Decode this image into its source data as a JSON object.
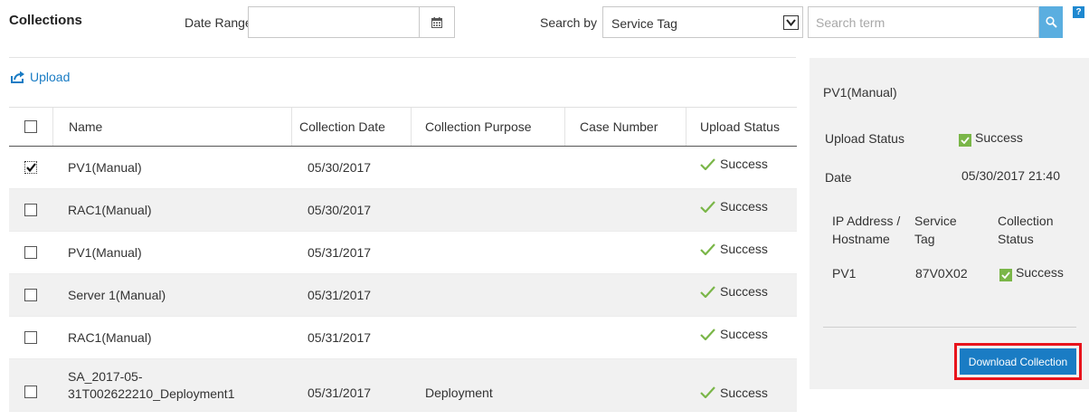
{
  "toolbar": {
    "title": "Collections",
    "date_range_label": "Date Range:",
    "date_range_value": "",
    "search_by_label": "Search by",
    "search_by_value": "Service Tag",
    "search_placeholder": "Search term",
    "help_label": "?"
  },
  "upload": {
    "label": "Upload"
  },
  "table": {
    "columns": [
      "Name",
      "Collection Date",
      "Collection Purpose",
      "Case Number",
      "Upload Status"
    ],
    "rows": [
      {
        "checked": true,
        "name": "PV1(Manual)",
        "date": "05/30/2017",
        "purpose": "",
        "case": "",
        "status": "Success"
      },
      {
        "checked": false,
        "name": "RAC1(Manual)",
        "date": "05/30/2017",
        "purpose": "",
        "case": "",
        "status": "Success"
      },
      {
        "checked": false,
        "name": "PV1(Manual)",
        "date": "05/31/2017",
        "purpose": "",
        "case": "",
        "status": "Success"
      },
      {
        "checked": false,
        "name": "Server 1(Manual)",
        "date": "05/31/2017",
        "purpose": "",
        "case": "",
        "status": "Success"
      },
      {
        "checked": false,
        "name": "RAC1(Manual)",
        "date": "05/31/2017",
        "purpose": "",
        "case": "",
        "status": "Success"
      },
      {
        "checked": false,
        "name_line1": "SA_2017-05-",
        "name_line2": "31T002622210_Deployment1",
        "date": "05/31/2017",
        "purpose": "Deployment",
        "case": "",
        "status": "Success"
      }
    ]
  },
  "details": {
    "title": "PV1(Manual)",
    "upload_status_label": "Upload Status",
    "upload_status_value": "Success",
    "date_label": "Date",
    "date_value": "05/30/2017 21:40",
    "sub_headers": {
      "ip_line1": "IP Address /",
      "ip_line2": "Hostname",
      "tag_line1": "Service",
      "tag_line2": "Tag",
      "cstatus_line1": "Collection",
      "cstatus_line2": "Status"
    },
    "entry": {
      "host": "PV1",
      "service_tag": "87V0X02",
      "status": "Success"
    },
    "download_label": "Download Collection"
  },
  "colors": {
    "accent": "#1a7cc4",
    "search_button": "#5aaee0",
    "success": "#7ab648",
    "highlight_frame": "#e8141c",
    "panel_bg": "#f1f1f1",
    "row_alt": "#f1f1f1"
  }
}
